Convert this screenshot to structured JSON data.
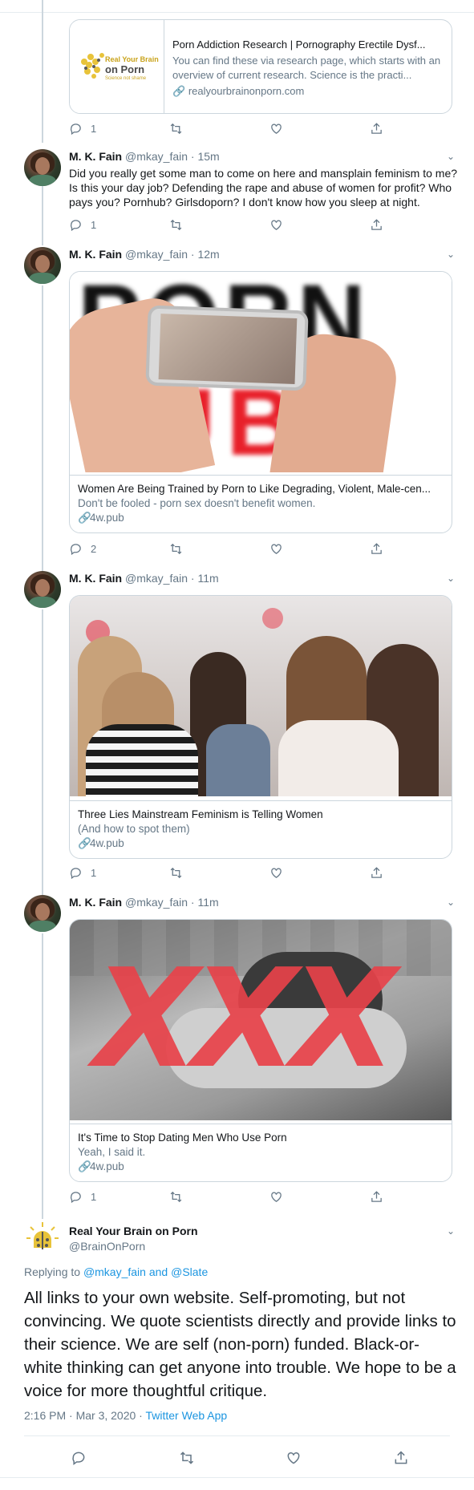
{
  "card0": {
    "title": "Porn Addiction Research | Pornography Erectile Dysf...",
    "desc": "You can find these via research page, which starts with an overview of current research. Science is the practi...",
    "link": "realyourbrainonporn.com",
    "logo_line1": "Real Your Brain",
    "logo_line2": "on Porn",
    "logo_line3": "Science not shame",
    "reply_count": "1"
  },
  "tweets": [
    {
      "name": "M. K. Fain",
      "handle": "@mkay_fain · 15m",
      "text": "Did you really get some man to come on here and mansplain feminism to me? Is this your day job? Defending the rape and abuse of women for profit? Who pays you? Pornhub? Girlsdoporn? I don't know how you sleep at night.",
      "reply_count": "1"
    },
    {
      "name": "M. K. Fain",
      "handle": "@mkay_fain · 12m",
      "card_title": "Women Are Being Trained by Porn to Like Degrading, Violent, Male-cen...",
      "card_desc": "Don't be fooled - porn sex doesn't benefit women.",
      "card_link": "4w.pub",
      "image_text_top": "PORN",
      "image_text_bottom": "TUBE",
      "reply_count": "2"
    },
    {
      "name": "M. K. Fain",
      "handle": "@mkay_fain · 11m",
      "card_title": "Three Lies Mainstream Feminism is Telling Women",
      "card_desc": "(And how to spot them)",
      "card_link": "4w.pub",
      "reply_count": "1"
    },
    {
      "name": "M. K. Fain",
      "handle": "@mkay_fain · 11m",
      "card_title": "It's Time to Stop Dating Men Who Use Porn",
      "card_desc": "Yeah, I said it.",
      "card_link": "4w.pub",
      "image_text": "XXX",
      "reply_count": "1"
    }
  ],
  "main": {
    "name": "Real Your Brain on Porn",
    "handle": "@BrainOnPorn",
    "replying_prefix": "Replying to",
    "mention1": "@mkay_fain",
    "and": "and",
    "mention2": "@Slate",
    "text": "All links to your own website. Self-promoting, but not convincing. We quote scientists directly and provide links to their science. We are self (non-porn) funded. Black-or-white thinking can get anyone into trouble. We hope to be a voice for more thoughtful critique.",
    "time": "2:16 PM · Mar 3, 2020 ·",
    "app": "Twitter Web App"
  },
  "icons": [
    "reply-icon",
    "retweet-icon",
    "like-icon",
    "share-icon",
    "chevron-down-icon",
    "link-icon"
  ],
  "colors": {
    "accent": "#1b95e0",
    "muted": "#657786",
    "border": "#ccd6dd",
    "red": "#e8202a"
  }
}
